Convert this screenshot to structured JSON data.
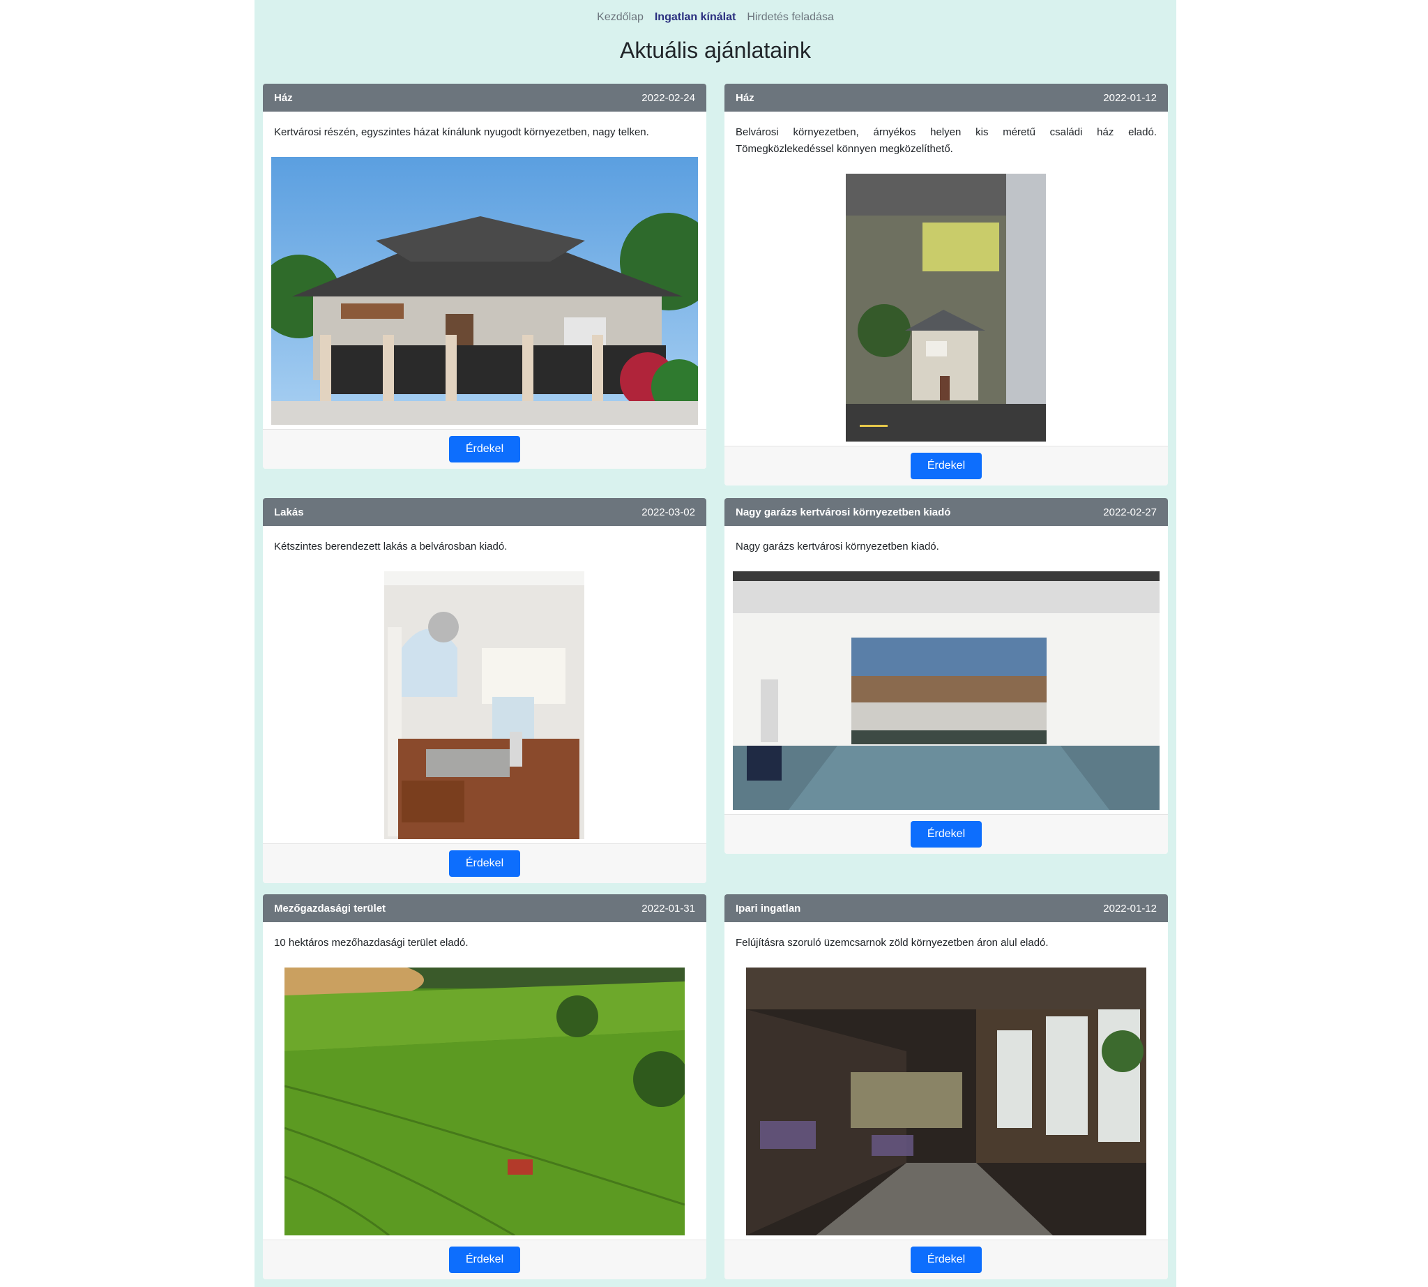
{
  "nav": {
    "items": [
      {
        "label": "Kezdőlap"
      },
      {
        "label": "Ingatlan kínálat"
      },
      {
        "label": "Hirdetés feladása"
      }
    ],
    "active_index": 1
  },
  "page_title": "Aktuális ajánlataink",
  "listings": [
    {
      "title": "Ház",
      "date": "2022-02-24",
      "description": "Kertvárosi részén, egyszintes házat kínálunk nyugodt környezetben, nagy telken.",
      "button": "Érdekel"
    },
    {
      "title": "Ház",
      "date": "2022-01-12",
      "description": "Belvárosi környezetben, árnyékos helyen kis méretű családi ház eladó. Tömegközlekedéssel könnyen megközelíthető.",
      "button": "Érdekel"
    },
    {
      "title": "Lakás",
      "date": "2022-03-02",
      "description": "Kétszintes berendezett lakás a belvárosban kiadó.",
      "button": "Érdekel"
    },
    {
      "title": "Nagy garázs kertvárosi környezetben kiadó",
      "date": "2022-02-27",
      "description": "Nagy garázs kertvárosi környezetben kiadó.",
      "button": "Érdekel"
    },
    {
      "title": "Mezőgazdasági terület",
      "date": "2022-01-31",
      "description": "10 hektáros mezőhazdasági terület eladó.",
      "button": "Érdekel"
    },
    {
      "title": "Ipari ingatlan",
      "date": "2022-01-12",
      "description": "Felújításra szoruló üzemcsarnok zöld környezetben áron alul eladó.",
      "button": "Érdekel"
    }
  ],
  "colors": {
    "page_bg": "#d9f2ee",
    "card_header": "#6c757d",
    "button": "#0d6efd",
    "nav_active": "#2a2f7f"
  }
}
